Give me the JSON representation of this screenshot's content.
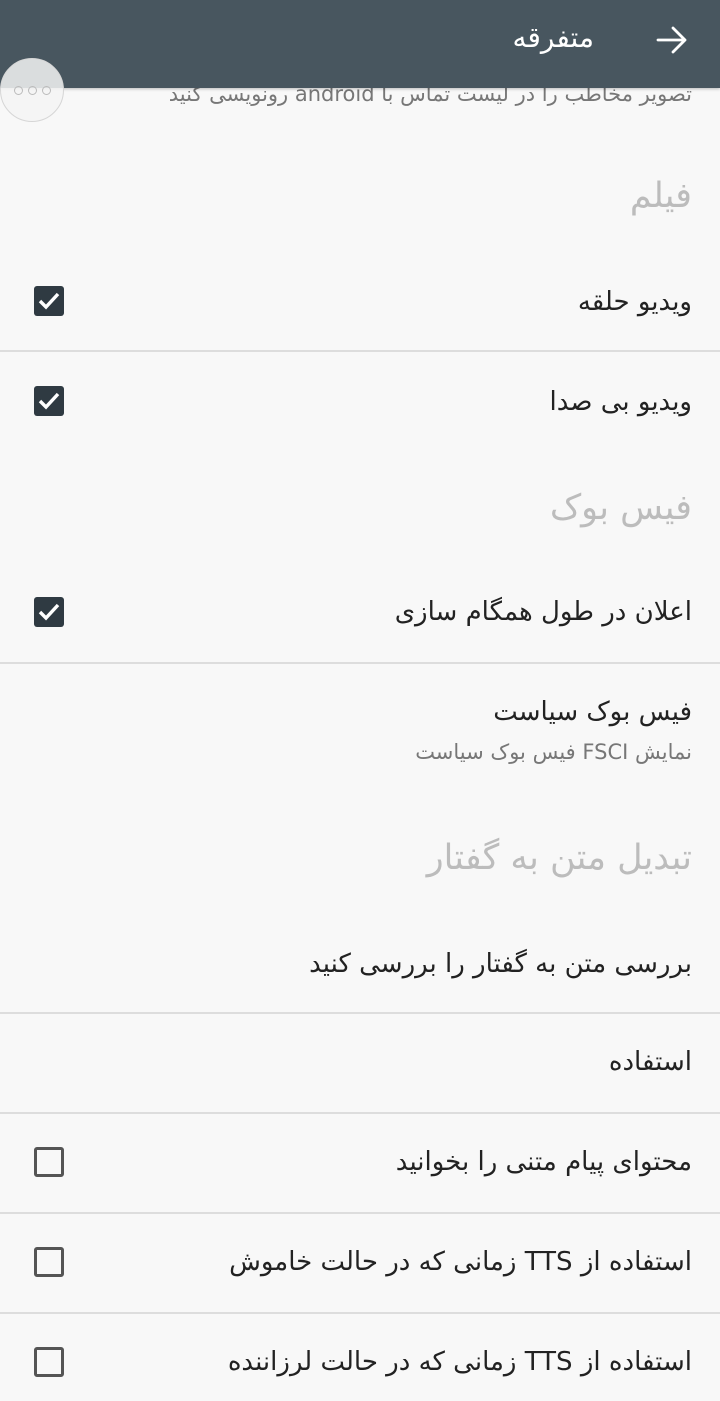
{
  "appbar": {
    "title": "متفرقه",
    "back_icon": "arrow-forward-icon"
  },
  "clipped_summary": "تصویر مخاطب را در لیست تماس با android رونویسی کنید",
  "sections": {
    "movie": {
      "header": "فیلم",
      "loop_video": {
        "title": "ویدیو حلقه",
        "checked": true
      },
      "mute_video": {
        "title": "ویدیو بی صدا",
        "checked": true
      }
    },
    "facebook": {
      "header": "فیس بوک",
      "sync_notify": {
        "title": "اعلان در طول همگام سازی",
        "checked": true
      },
      "policy": {
        "title": "فیس بوک سیاست",
        "summary": "نمایش FSCI فیس بوک سیاست"
      }
    },
    "tts": {
      "header": "تبدیل متن به گفتار",
      "check_tts": {
        "title": "بررسی متن به گفتار را بررسی کنید"
      },
      "usage": {
        "title": "استفاده"
      },
      "read_sms": {
        "title": "محتوای پیام متنی را بخوانید",
        "checked": false
      },
      "tts_silent": {
        "title": "استفاده از TTS زمانی که در حالت خاموش",
        "checked": false
      },
      "tts_vibrate": {
        "title": "استفاده از TTS زمانی که در حالت لرزاننده",
        "checked": false
      }
    }
  },
  "colors": {
    "appbar": "#48565f",
    "checkbox_on": "#2f3a42",
    "category_text": "#bcbcbc"
  }
}
